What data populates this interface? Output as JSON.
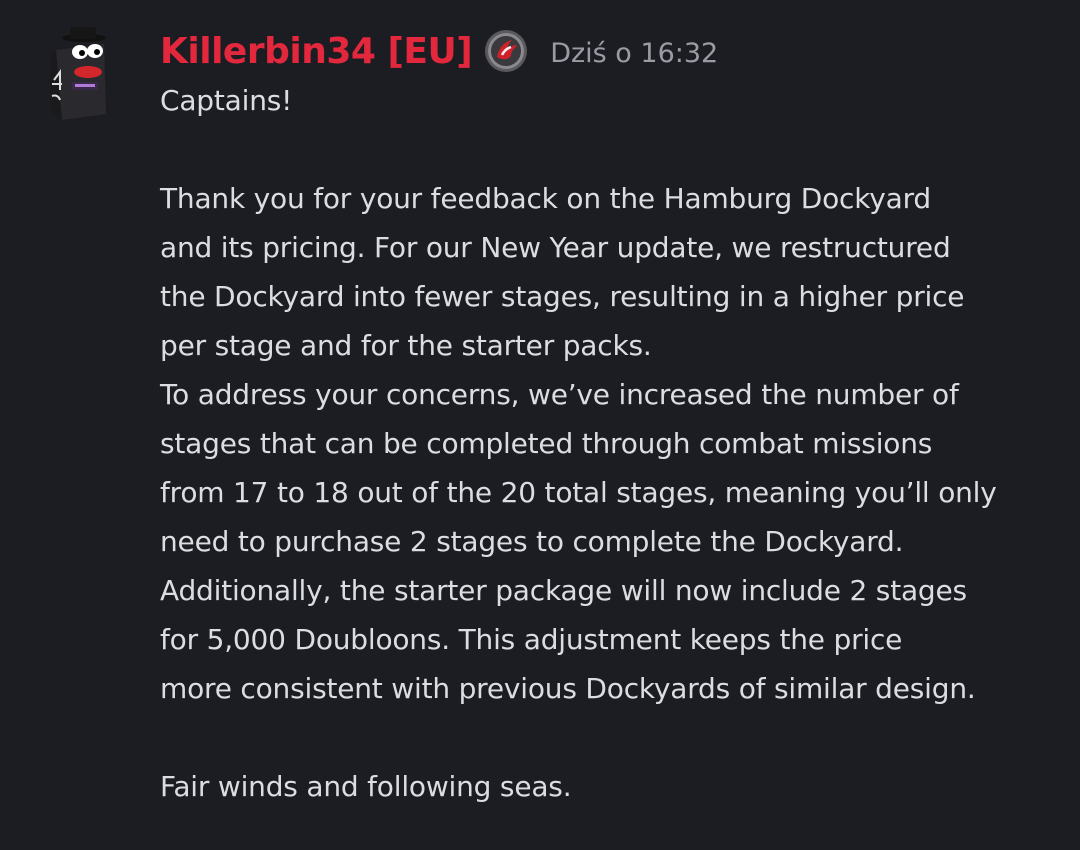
{
  "message": {
    "author": "Killerbin34 [EU]",
    "timestamp": "Dziś o 16:32",
    "avatar_icon": "cartoon-character-avatar",
    "badge_icon": "wargaming-logo-icon",
    "colors": {
      "background": "#1c1d22",
      "author": "#e3283e",
      "text": "#dbdee1",
      "timestamp": "#9a9ca5"
    },
    "lines": [
      "Captains!",
      "",
      "Thank you for your feedback on the Hamburg Dockyard",
      "and its pricing. For our New Year update, we restructured",
      "the Dockyard into fewer stages, resulting in a higher price",
      "per stage and for the starter packs.",
      "To address your concerns, we’ve increased the number of",
      "stages that can be completed through combat missions",
      "from 17 to 18 out of the 20 total stages, meaning you’ll only",
      "need to purchase 2 stages to complete the Dockyard.",
      "Additionally, the starter package will now include 2 stages",
      "for 5,000 Doubloons. This adjustment keeps the price",
      "more consistent with previous Dockyards of similar design.",
      "",
      "Fair winds and following seas."
    ]
  }
}
